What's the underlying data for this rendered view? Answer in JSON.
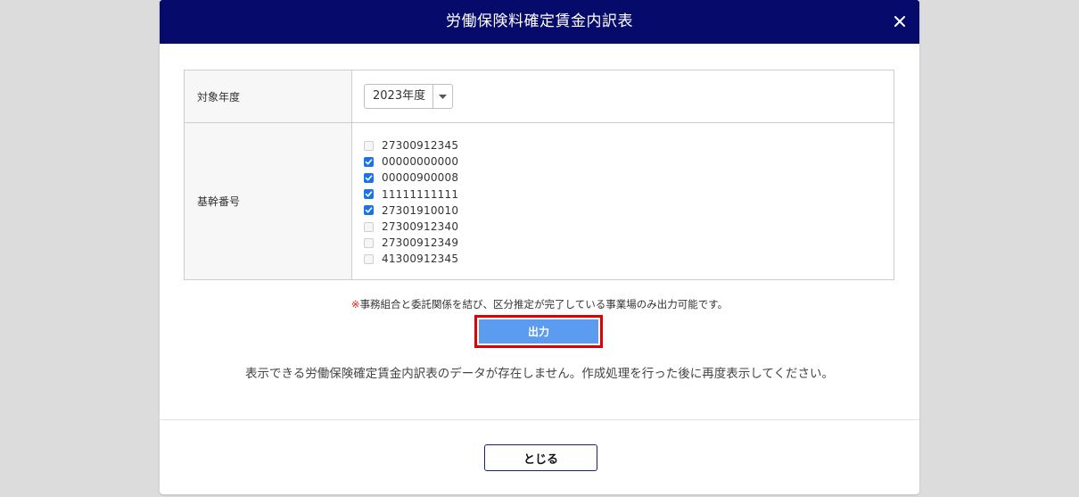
{
  "dialog": {
    "title": "労働保険料確定賃金内訳表",
    "close_icon": "close-icon",
    "header_color": "#060a6b"
  },
  "form": {
    "year_label": "対象年度",
    "year_value": "2023年度",
    "kikan_label": "基幹番号",
    "kikan_items": [
      {
        "number": "27300912345",
        "checked": false
      },
      {
        "number": "00000000000",
        "checked": true
      },
      {
        "number": "00000900008",
        "checked": true
      },
      {
        "number": "11111111111",
        "checked": true
      },
      {
        "number": "27301910010",
        "checked": true
      },
      {
        "number": "27300912340",
        "checked": false
      },
      {
        "number": "27300912349",
        "checked": false
      },
      {
        "number": "41300912345",
        "checked": false
      }
    ]
  },
  "notice": {
    "mark": "※",
    "text": "事務組合と委託関係を結び、区分推定が完了している事業場のみ出力可能です。"
  },
  "output_button": {
    "label": "出力",
    "color": "#5b9cf0",
    "highlight_color": "#e00000"
  },
  "message": "表示できる労働保険確定賃金内訳表のデータが存在しません。作成処理を行った後に再度表示してください。",
  "footer": {
    "close_label": "とじる"
  }
}
